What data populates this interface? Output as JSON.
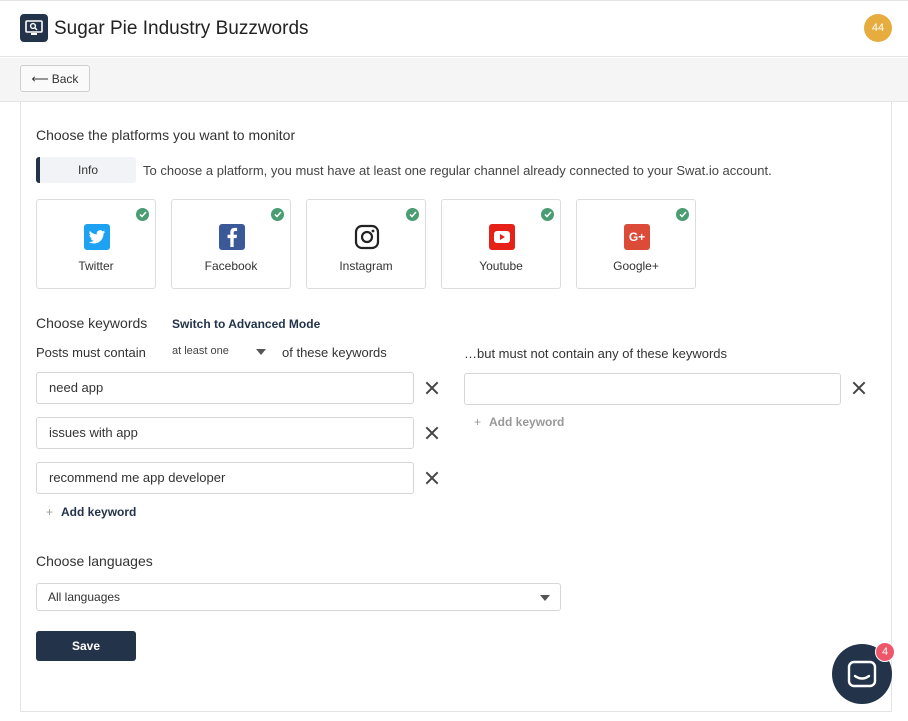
{
  "header": {
    "title": "Sugar Pie Industry Buzzwords",
    "user_badge": "44"
  },
  "subbar": {
    "back_label": "Back"
  },
  "platforms_section": {
    "title": "Choose the platforms you want to monitor",
    "info_tag": "Info",
    "info_text": "To choose a platform, you must have at least one regular channel already connected to your Swat.io account.",
    "items": [
      {
        "label": "Twitter",
        "icon": "twitter-icon",
        "color": "#1da1f2",
        "selected": true
      },
      {
        "label": "Facebook",
        "icon": "facebook-icon",
        "color": "#3b5998",
        "selected": true
      },
      {
        "label": "Instagram",
        "icon": "instagram-icon",
        "color": "#222222",
        "selected": true
      },
      {
        "label": "Youtube",
        "icon": "youtube-icon",
        "color": "#e62117",
        "selected": true
      },
      {
        "label": "Google+",
        "icon": "google-plus-icon",
        "color": "#dc4a38",
        "selected": true
      }
    ]
  },
  "keywords_section": {
    "title": "Choose keywords",
    "advanced_link": "Switch to Advanced Mode",
    "must_contain_prefix": "Posts must contain",
    "match_mode": "at least one",
    "must_contain_suffix": "of these keywords",
    "must_not_label": "…but must not contain any of these keywords",
    "include_keywords": [
      "need app",
      "issues with app",
      "recommend me app developer"
    ],
    "exclude_keywords": [
      ""
    ],
    "add_keyword_label": "Add keyword"
  },
  "languages_section": {
    "title": "Choose languages",
    "selected": "All languages"
  },
  "save_label": "Save",
  "chat": {
    "unread_count": "4"
  },
  "colors": {
    "brand_navy": "#23344a",
    "check_green": "#4a9d72",
    "badge_orange": "#e6ac3e",
    "chat_badge_red": "#f0566a"
  }
}
